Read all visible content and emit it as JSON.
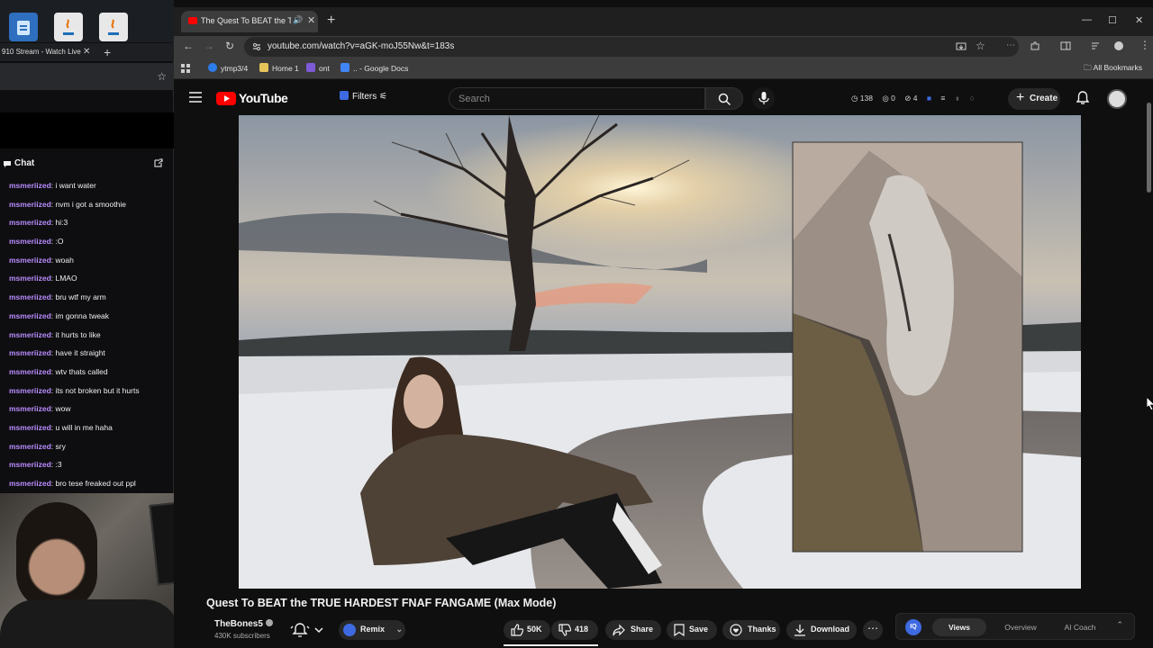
{
  "left_window": {
    "tab_title": "910 Stream - Watch Live",
    "chat": {
      "title": "Chat",
      "messages": [
        {
          "user": "msmeriized",
          "text": ": i want water"
        },
        {
          "user": "msmeriized",
          "text": ": nvm i got a smoothie"
        },
        {
          "user": "msmeriized",
          "text": ": hi:3"
        },
        {
          "user": "msmeriized",
          "text": ": :O"
        },
        {
          "user": "msmeriized",
          "text": ": woah"
        },
        {
          "user": "msmeriized",
          "text": ": LMAO"
        },
        {
          "user": "msmeriized",
          "text": ": bru wtf my arm"
        },
        {
          "user": "msmeriized",
          "text": ": im gonna tweak"
        },
        {
          "user": "msmeriized",
          "text": ": it hurts to like"
        },
        {
          "user": "msmeriized",
          "text": ": have it straight"
        },
        {
          "user": "msmeriized",
          "text": ": wtv thats called"
        },
        {
          "user": "msmeriized",
          "text": ": its not broken but it hurts"
        },
        {
          "user": "msmeriized",
          "text": ": wow"
        },
        {
          "user": "msmeriized",
          "text": ": u will in me haha"
        },
        {
          "user": "msmeriized",
          "text": ": sry"
        },
        {
          "user": "msmeriized",
          "text": ": :3"
        },
        {
          "user": "msmeriized",
          "text": ": bro tese freaked out ppl"
        }
      ]
    }
  },
  "browser": {
    "tab_title": "The Quest To BEAT the TRUE",
    "url": "youtube.com/watch?v=aGK-moJ55Nw&t=183s",
    "bookmarks": [
      "ytmp3/4",
      "Home 1",
      "ont",
      ".. - Google Docs"
    ],
    "all_bookmarks": "All Bookmarks"
  },
  "youtube": {
    "logo_text": "YouTube",
    "filters_label": "Filters",
    "search_placeholder": "Search",
    "stats": [
      "138",
      "0",
      "4"
    ],
    "create_label": "Create",
    "video_title": "Quest To BEAT the TRUE HARDEST FNAF FANGAME (Max Mode)",
    "channel_name": "TheBones5",
    "subscribers": "430K subscribers",
    "remix_label": "Remix",
    "likes": "50K",
    "dislikes": "418",
    "share_label": "Share",
    "save_label": "Save",
    "thanks_label": "Thanks",
    "download_label": "Download",
    "iq_tabs": [
      "Views",
      "Overview",
      "AI Coach"
    ],
    "iq_logo": "IQ"
  },
  "colors": {
    "yt_red": "#ff0000",
    "chat_username": "#b98cff",
    "iq_blue": "#3e6ae1"
  }
}
